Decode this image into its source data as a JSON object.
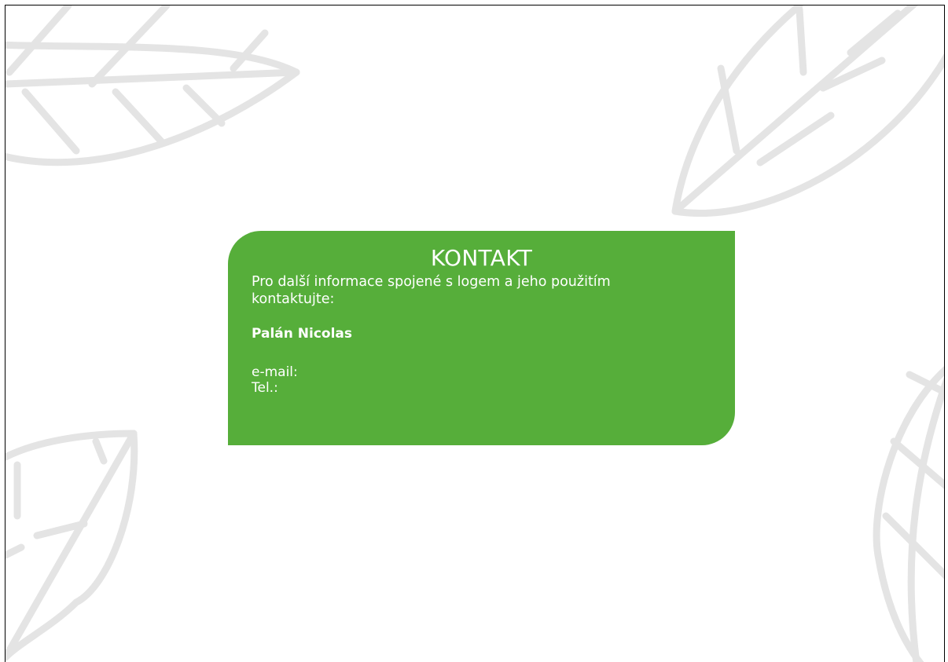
{
  "colors": {
    "card_background": "#56ae3a",
    "card_text": "#ffffff",
    "leaf_outline": "#e4e4e4"
  },
  "decorations": {
    "icon": "leaf-outline-icon"
  },
  "contact": {
    "title": "KONTAKT",
    "intro": "Pro další informace spojené s logem a jeho použitím kontaktujte:",
    "name": "Palán Nicolas",
    "email_label": "e-mail:",
    "phone_label": "Tel.:"
  }
}
